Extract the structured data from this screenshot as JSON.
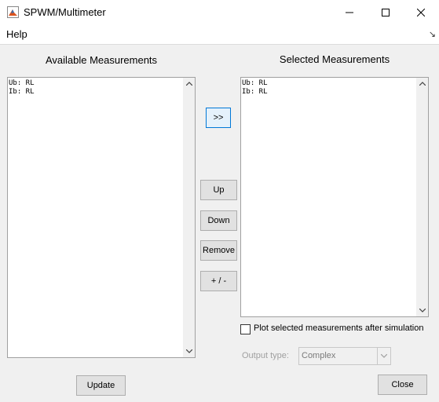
{
  "window": {
    "title": "SPWM/Multimeter",
    "controls": {
      "minimize": "minimize",
      "maximize": "maximize",
      "close": "close"
    }
  },
  "menu": {
    "help": "Help",
    "dock_arrow": "↘"
  },
  "available": {
    "title": "Available Measurements",
    "items": [
      "Ub: RL",
      "Ib: RL"
    ]
  },
  "selected": {
    "title": "Selected Measurements",
    "items": [
      "Ub: RL",
      "Ib: RL"
    ]
  },
  "buttons": {
    "add": ">>",
    "up": "Up",
    "down": "Down",
    "remove": "Remove",
    "sign": "+ / -",
    "update": "Update",
    "close": "Close"
  },
  "options": {
    "plot_after_sim": {
      "label": "Plot selected measurements after simulation",
      "checked": false
    },
    "output_type": {
      "label": "Output type:",
      "value": "Complex"
    }
  },
  "colors": {
    "focus_border": "#0078d7",
    "disabled_text": "#a0a0a0"
  }
}
